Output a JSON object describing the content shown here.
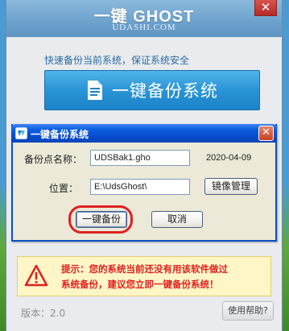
{
  "app": {
    "title": "一键 GHOST",
    "subtitle": "UDASHI.COM",
    "close_label": "✕",
    "tagline": "快速备份当前系统，保证系统安全",
    "main_button_label": "一键备份系统",
    "tip_line1": "提示：您的系统当前还没有用该软件做过",
    "tip_line2": "系统备份，建议您立即一键备份系统！",
    "version": "版本：2.0",
    "help_button": "使用帮助?"
  },
  "dialog": {
    "title": "一键备份系统",
    "close_label": "✕",
    "name_label": "备份点名称：",
    "name_value": "UDSBak1.gho",
    "date": "2020-04-09",
    "location_label": "位置：",
    "location_value": "E:\\UdsGhost\\",
    "mirror_button": "镜像管理",
    "backup_button": "一键备份",
    "cancel_button": "取消"
  },
  "colors": {
    "accent_blue": "#2a95d6",
    "xp_titlebar": "#0848c8",
    "warning_red": "#e0211f",
    "highlight_ring": "#e02020"
  }
}
